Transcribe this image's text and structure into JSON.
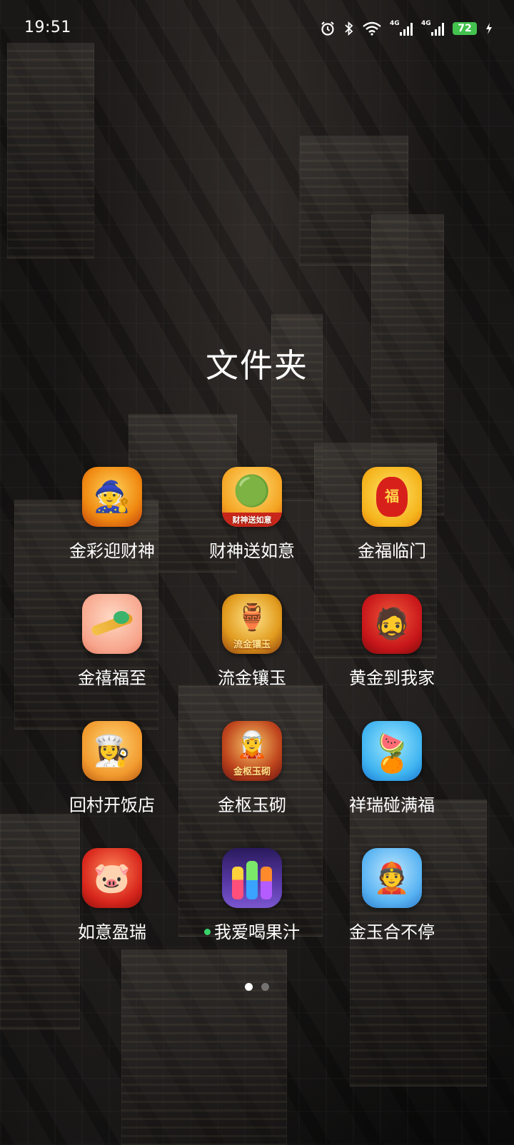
{
  "status_bar": {
    "time": "19:51",
    "battery": "72",
    "network_1": "4G",
    "network_2": "4G",
    "icons": [
      "alarm-icon",
      "bluetooth-icon",
      "wifi-icon",
      "signal-icon",
      "signal-icon",
      "battery-icon",
      "charging-icon"
    ]
  },
  "folder": {
    "title": "文件夹",
    "apps": [
      {
        "label": "金彩迎财神",
        "icon": "god-of-wealth-icon",
        "new": false
      },
      {
        "label": "财神送如意",
        "icon": "jade-ruyi-icon",
        "icon_text": "财神送如意",
        "new": false
      },
      {
        "label": "金福临门",
        "icon": "fortune-bag-icon",
        "icon_text": "福",
        "new": false
      },
      {
        "label": "金禧福至",
        "icon": "ruyi-scepter-icon",
        "new": false
      },
      {
        "label": "流金镶玉",
        "icon": "treasure-pot-icon",
        "icon_text": "流金镶玉",
        "new": false
      },
      {
        "label": "黄金到我家",
        "icon": "bearded-god-icon",
        "new": false
      },
      {
        "label": "回村开饭店",
        "icon": "chef-girl-icon",
        "new": false
      },
      {
        "label": "金枢玉砌",
        "icon": "warrior-god-icon",
        "icon_text": "金枢玉砌",
        "new": false
      },
      {
        "label": "祥瑞碰满福",
        "icon": "fruit-match-icon",
        "new": false
      },
      {
        "label": "如意盈瑞",
        "icon": "lucky-pig-icon",
        "new": false
      },
      {
        "label": "我爱喝果汁",
        "icon": "juice-bottles-icon",
        "new": true
      },
      {
        "label": "金玉合不停",
        "icon": "rich-boy-icon",
        "new": false
      }
    ]
  },
  "pagination": {
    "pages": 2,
    "current": 1
  }
}
